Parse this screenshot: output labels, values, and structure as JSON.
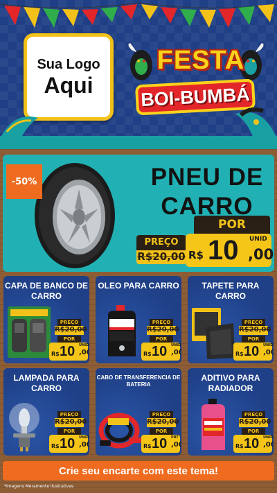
{
  "header": {
    "logo_line1": "Sua Logo",
    "logo_line2": "Aqui",
    "festa_title": "FESTA",
    "boi_title": "BOI-BUMBÁ"
  },
  "hero": {
    "discount": "-50%",
    "title_line1": "PNEU DE",
    "title_line2": "CARRO",
    "preco_label": "PREÇO",
    "old_price": "R$20,00",
    "por_label": "POR",
    "currency": "R$",
    "price_int": "10",
    "price_dec": ",00",
    "unit": "UNID"
  },
  "products": [
    {
      "title": "CAPA DE BANCO DE CARRO",
      "preco_label": "PREÇO",
      "old_price": "R$20,00",
      "por_label": "POR",
      "currency": "R$",
      "price_int": "10",
      "price_dec": ",00",
      "unit": "UNID",
      "icon": "seat-cover-icon"
    },
    {
      "title": "OLEO PARA CARRO",
      "preco_label": "PREÇO",
      "old_price": "R$20,00",
      "por_label": "POR",
      "currency": "R$",
      "price_int": "10",
      "price_dec": ",00",
      "unit": "UNID",
      "icon": "motor-oil-icon"
    },
    {
      "title": "TAPETE PARA CARRO",
      "preco_label": "PREÇO",
      "old_price": "R$20,00",
      "por_label": "POR",
      "currency": "R$",
      "price_int": "10",
      "price_dec": ",00",
      "unit": "UNID",
      "icon": "car-mat-icon"
    },
    {
      "title": "LAMPADA PARA CARRO",
      "preco_label": "PREÇO",
      "old_price": "R$20,00",
      "por_label": "POR",
      "currency": "R$",
      "price_int": "10",
      "price_dec": ",00",
      "unit": "UNID",
      "icon": "headlight-bulb-icon"
    },
    {
      "title": "CABO DE TRANSFERENCIA DE BATERIA",
      "preco_label": "PREÇO",
      "old_price": "R$20,00",
      "por_label": "POR",
      "currency": "R$",
      "price_int": "10",
      "price_dec": ",00",
      "unit": "PRT",
      "icon": "jumper-cable-icon"
    },
    {
      "title": "ADITIVO PARA RADIADOR",
      "preco_label": "PREÇO",
      "old_price": "R$20,00",
      "por_label": "POR",
      "currency": "R$",
      "price_int": "10",
      "price_dec": ",00",
      "unit": "UNID",
      "icon": "coolant-bottle-icon"
    }
  ],
  "cta": "Crie seu encarte com este tema!",
  "disclaimer": "*Imagens Meramente Ilustrativas",
  "colors": {
    "header_bg": "#1f3f86",
    "accent_yellow": "#f5c518",
    "accent_orange": "#ee6b1f",
    "hero_teal": "#21b1b4",
    "wood": "#8a5a35"
  }
}
